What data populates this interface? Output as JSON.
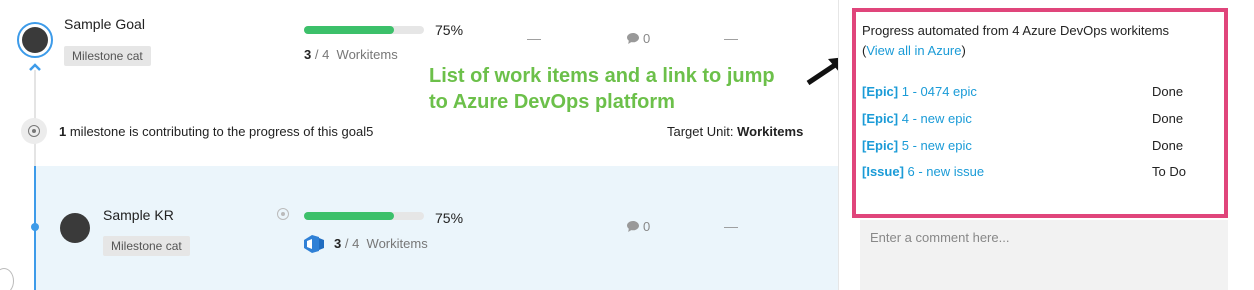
{
  "goal": {
    "title": "Sample Goal",
    "tag": "Milestone cat",
    "progress_percent": 75,
    "progress_label": "75%",
    "workitems_done": "3",
    "workitems_sep": " / ",
    "workitems_total": "4",
    "workitems_label": "Workitems",
    "dash1": "—",
    "dash2": "—",
    "comments": "0"
  },
  "milestone_row": {
    "count": "1",
    "text": " milestone is contributing to the progress of this goal5",
    "target_label": "Target Unit: ",
    "target_value": "Workitems"
  },
  "kr": {
    "title": "Sample KR",
    "tag": "Milestone cat",
    "progress_percent": 75,
    "progress_label": "75%",
    "workitems_done": "3",
    "workitems_sep": " / ",
    "workitems_total": "4",
    "workitems_label": "Workitems",
    "comments": "0",
    "dash": "—"
  },
  "annotation": {
    "line1": "List of work items and a link to jump",
    "line2": "to Azure DevOps platform"
  },
  "popup": {
    "header": "Progress automated from 4 Azure DevOps workitems",
    "open_paren": "(",
    "link": "View all in Azure",
    "close_paren": ")",
    "items": [
      {
        "type": "[Epic]",
        "title": " 1 - 0474 epic",
        "status": "Done"
      },
      {
        "type": "[Epic]",
        "title": " 4 - new epic",
        "status": "Done"
      },
      {
        "type": "[Epic]",
        "title": " 5 - new epic",
        "status": "Done"
      },
      {
        "type": "[Issue]",
        "title": " 6 - new issue",
        "status": "To Do"
      }
    ]
  },
  "comment_box": {
    "placeholder": "Enter a comment here..."
  },
  "colors": {
    "accent_blue": "#3d9be9",
    "progress_green": "#3cc06a",
    "annotation_green": "#6cc04a",
    "highlight_pink": "#e0457b",
    "link_blue": "#1a9bd7"
  }
}
